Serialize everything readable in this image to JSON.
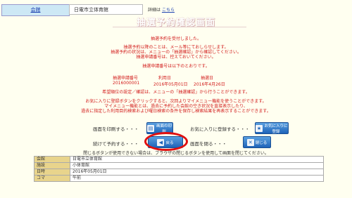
{
  "header": {
    "tab_label": "会館",
    "venue_name": "日電市立体育館",
    "detail_label": "詳細は",
    "detail_link": "こちら"
  },
  "title": "抽選予約確認画面",
  "messages": {
    "accepted": "抽選予約を受付しました。",
    "line1": "抽選予約以降のことは、メール等にておしらせします。",
    "line2": "抽選予約の状況は、メニューの「抽選確認」から確認してください。",
    "line3": "抽選申請番号は、控えておいてください。",
    "number_notice": "抽選申請番号は以下のとおりです。",
    "preference": "希望順位の設定／確認は、メニューの「抽選確認」から行うことができます。",
    "fav1": "お気に入りに登録ボタンをクリックすると、次回よりマイメニュー機能を使うことができます。",
    "fav2": "マイメニュー機能とは、過去に予約した会館の空き状況を直接表示したり、",
    "fav3": "過去に指定した利用目的検索および曜日検索の条件を保存し検索結果を再表示することができます。"
  },
  "columns": {
    "number_header": "抽選申請番号",
    "date_header": "利用日",
    "entry_header": "抽選日",
    "number": "2016000001",
    "date": "2016年05月01日",
    "entry": "2016年4月26日"
  },
  "actions": {
    "print_label": "画面を印刷する・・・",
    "print_btn": "画面の印刷",
    "fav_label": "お気に入りに登録する・・・",
    "fav_btn": "お気に入りに登録",
    "continue_label": "続けて予約する・・・",
    "back_btn": "戻る",
    "close_label": "画面を閉る・・・",
    "close_btn": "閉じる"
  },
  "note": "閉じるボタンが使用できない場合は、ブラウザの閉じるボタンを使用して画面を閉じてください。",
  "details": [
    {
      "label": "会館",
      "value": "日電市立体育館"
    },
    {
      "label": "施設",
      "value": "小体育館"
    },
    {
      "label": "日時",
      "value": "2016年05月01日"
    },
    {
      "label": "コマ",
      "value": "午前"
    }
  ]
}
